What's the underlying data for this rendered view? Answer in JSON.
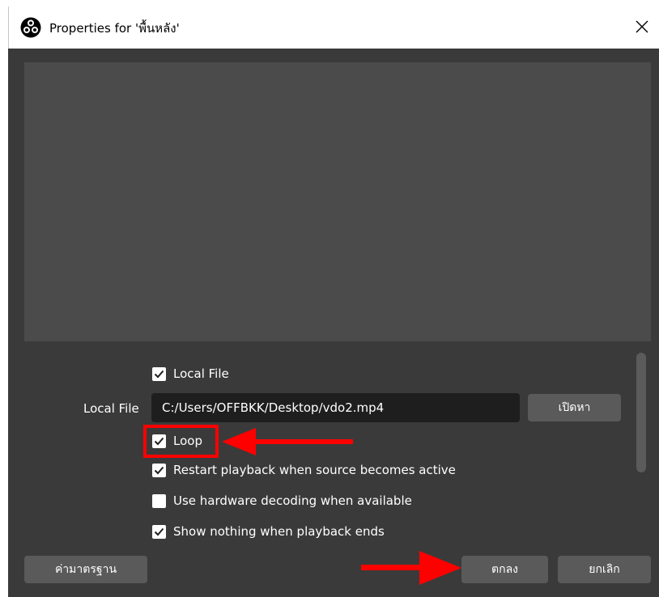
{
  "window": {
    "title": "Properties for 'พื้นหลัง'",
    "app_icon": "obs-logo-icon",
    "close_icon": "close-icon"
  },
  "preview": {},
  "options": {
    "local_file_checkbox": {
      "label": "Local File",
      "checked": true
    },
    "local_file_field": {
      "label": "Local File",
      "value": "C:/Users/OFFBKK/Desktop/vdo2.mp4"
    },
    "browse_button": "เปิดหา",
    "loop": {
      "label": "Loop",
      "checked": true
    },
    "restart": {
      "label": "Restart playback when source becomes active",
      "checked": true
    },
    "hw_decoding": {
      "label": "Use hardware decoding when available",
      "checked": false
    },
    "show_nothing": {
      "label": "Show nothing when playback ends",
      "checked": true
    }
  },
  "footer": {
    "defaults_button": "ค่ามาตรฐาน",
    "ok_button": "ตกลง",
    "cancel_button": "ยกเลิก"
  },
  "annotations": {
    "color": "#ff0000"
  }
}
